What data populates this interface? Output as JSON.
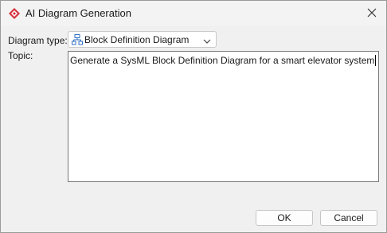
{
  "window": {
    "title": "AI Diagram Generation",
    "accent_color": "#d6343d"
  },
  "form": {
    "diagram_type_label": "Diagram type:",
    "diagram_type_value": "Block Definition Diagram",
    "diagram_type_icon": "block-diagram-icon",
    "topic_label": "Topic:",
    "topic_value": "Generate a SysML Block Definition Diagram for a smart elevator system"
  },
  "buttons": {
    "ok_label": "OK",
    "cancel_label": "Cancel"
  }
}
